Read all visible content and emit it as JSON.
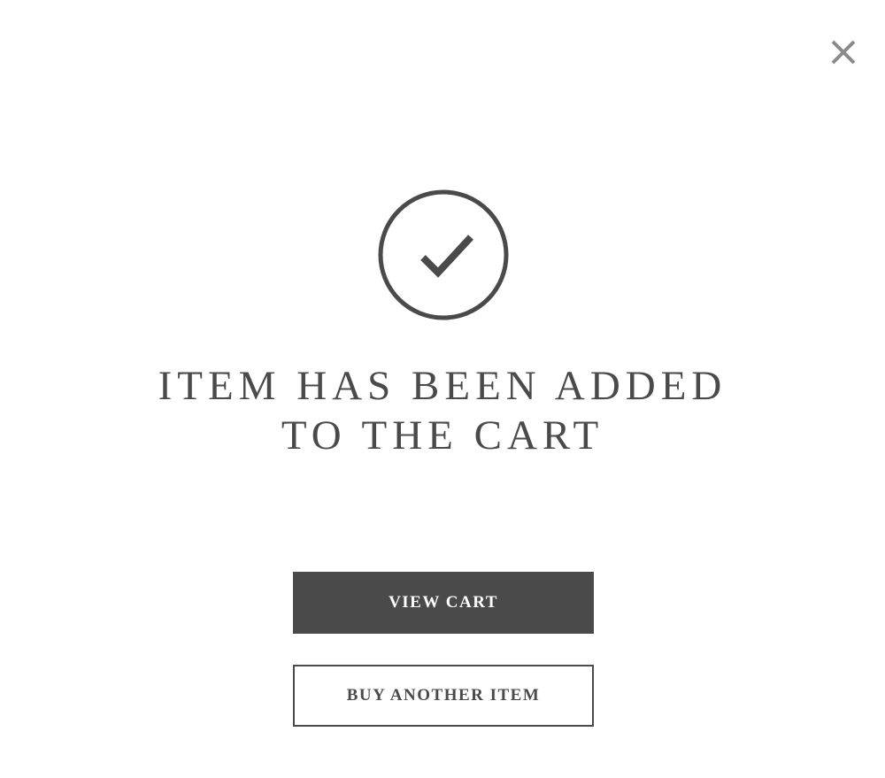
{
  "modal": {
    "title_line1": "ITEM HAS BEEN ADDED",
    "title_line2": "TO THE CART",
    "close_icon": "close-icon",
    "status_icon": "checkmark-circle-icon"
  },
  "actions": {
    "view_cart_label": "VIEW CART",
    "buy_another_label": "BUY ANOTHER ITEM"
  },
  "colors": {
    "text": "#4a4a4a",
    "primary_button_bg": "#4a4a4a",
    "primary_button_text": "#ffffff",
    "background": "#ffffff",
    "close_icon": "#8a8a8a"
  }
}
